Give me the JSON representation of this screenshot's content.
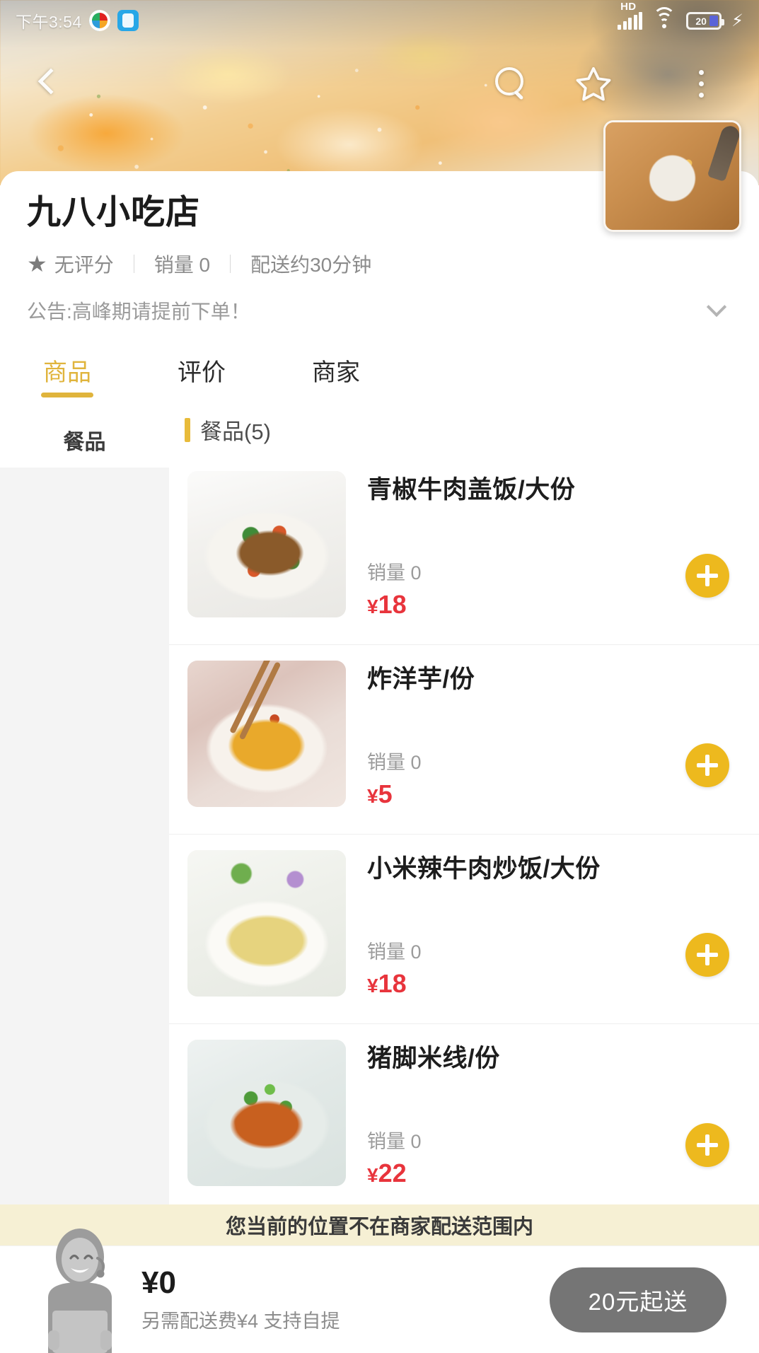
{
  "status_bar": {
    "time": "下午3:54",
    "app_icons": [
      "weibo-icon",
      "alipay-icon"
    ],
    "network_label": "HD",
    "signal": "signal-icon",
    "wifi": "wifi-icon",
    "battery_percent": "20",
    "charging": "bolt-icon"
  },
  "hero": {
    "back": "back-chevron-icon",
    "search": "search-icon",
    "favorite": "star-icon",
    "more": "more-vertical-icon"
  },
  "shop": {
    "name": "九八小吃店",
    "rating": "无评分",
    "sales": "销量 0",
    "delivery_time": "配送约30分钟",
    "notice": "公告:高峰期请提前下单！",
    "logo_alt": "猪脚米线"
  },
  "tabs": [
    {
      "label": "商品",
      "active": true
    },
    {
      "label": "评价",
      "active": false
    },
    {
      "label": "商家",
      "active": false
    }
  ],
  "sidebar": {
    "items": [
      {
        "label": "餐品",
        "active": true
      }
    ]
  },
  "menu": {
    "category_title": "餐品(5)",
    "add_label": "+",
    "items": [
      {
        "name": "青椒牛肉盖饭/大份",
        "sales": "销量 0",
        "currency": "¥",
        "price": "18",
        "photo": "ph1"
      },
      {
        "name": "炸洋芋/份",
        "sales": "销量 0",
        "currency": "¥",
        "price": "5",
        "photo": "ph2"
      },
      {
        "name": "小米辣牛肉炒饭/大份",
        "sales": "销量 0",
        "currency": "¥",
        "price": "18",
        "photo": "ph3"
      },
      {
        "name": "猪脚米线/份",
        "sales": "销量 0",
        "currency": "¥",
        "price": "22",
        "photo": "ph4"
      }
    ]
  },
  "bottom": {
    "alert": "您当前的位置不在商家配送范围内",
    "cart_total": "¥0",
    "cart_sub": "另需配送费¥4  支持自提",
    "order_button": "20元起送",
    "courier_icon": "courier-icon"
  },
  "colors": {
    "accent": "#e0b43c",
    "add_button": "#edb91e",
    "price": "#e8343c",
    "alert_bg": "#f6f0d4",
    "order_btn_bg": "#757575"
  }
}
